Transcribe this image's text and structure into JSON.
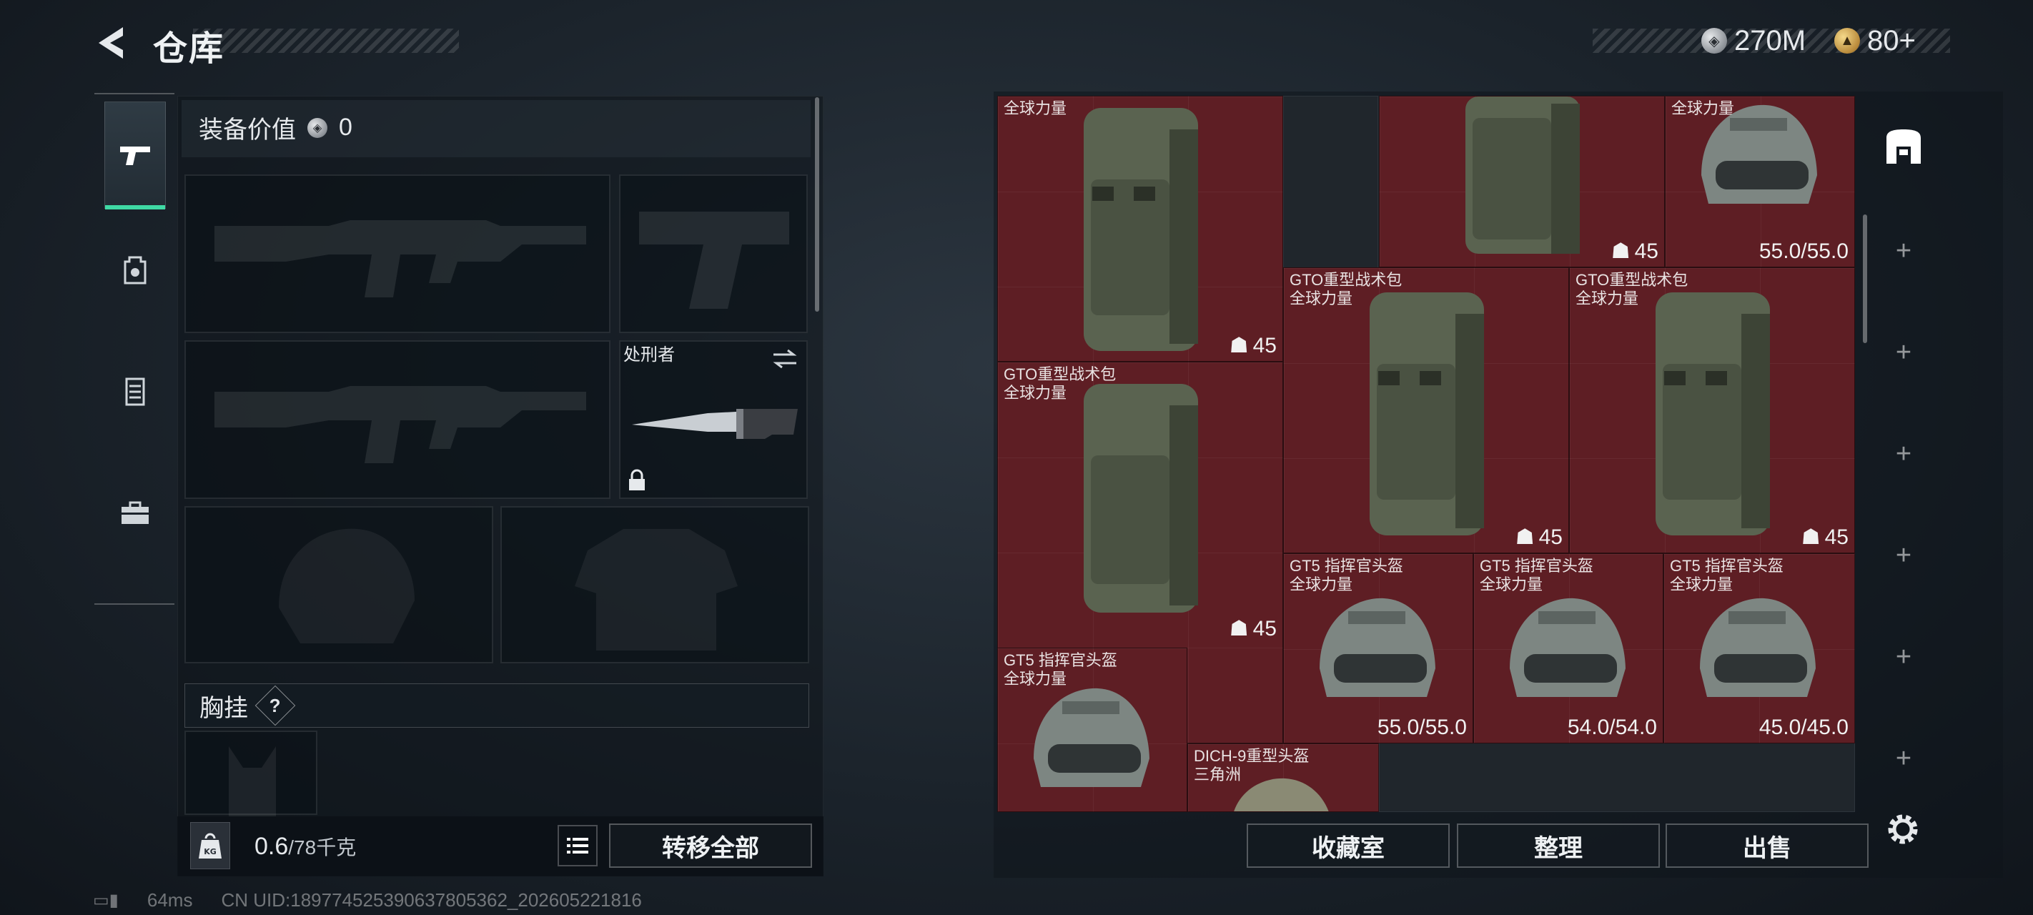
{
  "header": {
    "title": "仓库",
    "currency_silver": "270M",
    "currency_gold": "80+"
  },
  "side_nav": [
    "weapons",
    "backpack",
    "armor-vest",
    "toolbox"
  ],
  "equipment": {
    "value_label": "装备价值",
    "value": "0",
    "melee_name": "处刑者",
    "chest_rig_label": "胸挂",
    "chest_rig_help": "?"
  },
  "weight": {
    "current": "0.6",
    "capacity": "/78千克",
    "icon_text": "KG"
  },
  "buttons": {
    "transfer_all": "转移全部",
    "collection": "收藏室",
    "sort": "整理",
    "sell": "出售"
  },
  "inventory": {
    "items": [
      {
        "id": "bp1",
        "name": "",
        "sub": "全球力量",
        "stat": "45",
        "type": "backpack"
      },
      {
        "id": "bp2",
        "name": "",
        "sub": "",
        "stat": "45",
        "type": "backpack"
      },
      {
        "id": "h1",
        "name": "",
        "sub": "全球力量",
        "stat": "55.0/55.0",
        "type": "helmet"
      },
      {
        "id": "bp3",
        "name": "GTO重型战术包",
        "sub": "全球力量",
        "stat": "45",
        "type": "backpack"
      },
      {
        "id": "bp4",
        "name": "GTO重型战术包",
        "sub": "全球力量",
        "stat": "45",
        "type": "backpack"
      },
      {
        "id": "bp5",
        "name": "GTO重型战术包",
        "sub": "全球力量",
        "stat": "45",
        "type": "backpack"
      },
      {
        "id": "h2",
        "name": "GT5 指挥官头盔",
        "sub": "全球力量",
        "stat": "55.0/55.0",
        "type": "helmet"
      },
      {
        "id": "h3",
        "name": "GT5 指挥官头盔",
        "sub": "全球力量",
        "stat": "54.0/54.0",
        "type": "helmet"
      },
      {
        "id": "h4",
        "name": "GT5 指挥官头盔",
        "sub": "全球力量",
        "stat": "45.0/45.0",
        "type": "helmet"
      },
      {
        "id": "h5",
        "name": "GT5 指挥官头盔",
        "sub": "全球力量",
        "stat": "",
        "type": "helmet"
      },
      {
        "id": "h6",
        "name": "DICH-9重型头盔",
        "sub": "三角洲",
        "stat": "",
        "type": "helmet"
      }
    ]
  },
  "footer": {
    "ping": "64ms",
    "uid": "CN UID:18977452539063780536​2_202605221816"
  },
  "colors": {
    "accent": "#3fd9a4",
    "item_bg": "#5e1e24"
  }
}
